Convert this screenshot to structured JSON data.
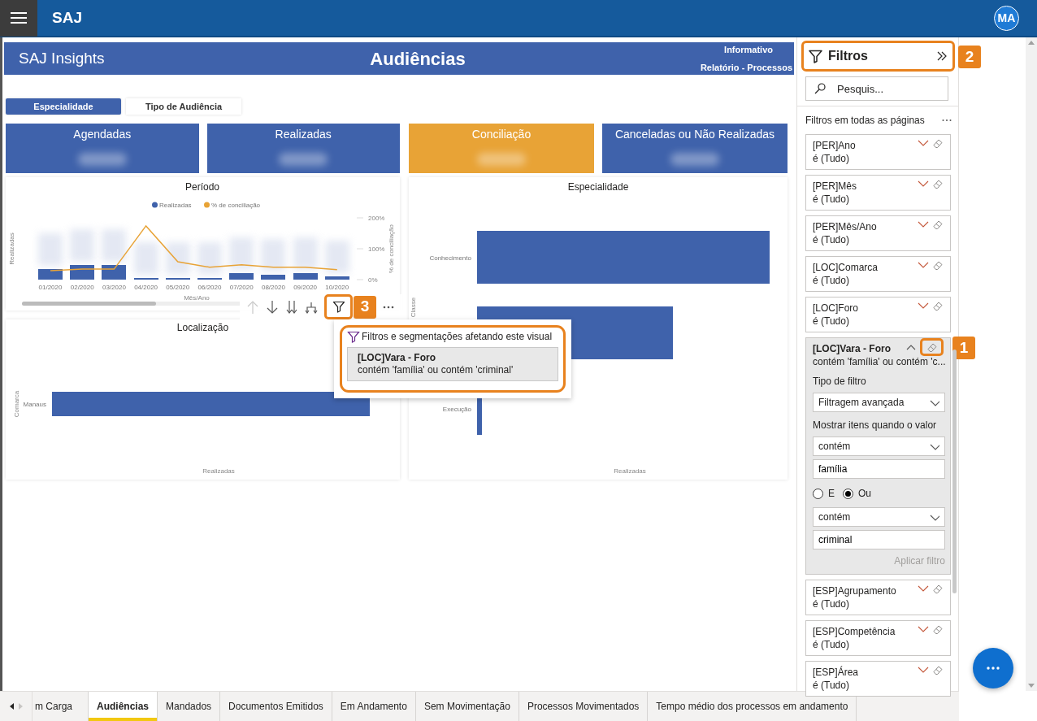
{
  "app": {
    "title": "SAJ",
    "user_initials": "MA"
  },
  "report": {
    "brand": "SAJ Insights",
    "title": "Audiências",
    "nav_links": [
      {
        "label": "Informativo"
      },
      {
        "label": "Relatório - Processos"
      }
    ],
    "toggles": [
      {
        "label": "Especialidade",
        "selected": true
      },
      {
        "label": "Tipo de Audiência",
        "selected": false
      }
    ],
    "kpis": [
      {
        "label": "Agendadas",
        "color": "#3f62ab"
      },
      {
        "label": "Realizadas",
        "color": "#3f62ab"
      },
      {
        "label": "Conciliação",
        "color": "#e8a336"
      },
      {
        "label": "Canceladas ou Não Realizadas",
        "color": "#3f62ab"
      }
    ],
    "periodo": {
      "title": "Período",
      "left_axis_title": "Realizadas",
      "legend": [
        {
          "label": "Realizadas",
          "color": "#3f62ab"
        }
      ],
      "chart_data": {
        "type": "line",
        "xlabel": "Mês/Ano",
        "ylabel": "% de conciliação",
        "categories": [
          "01/2020",
          "02/2020",
          "03/2020",
          "04/2020",
          "05/2020",
          "06/2020",
          "07/2020",
          "08/2020",
          "09/2020",
          "10/2020"
        ],
        "ylim": [
          0,
          200
        ],
        "yticks": [
          {
            "value": 0,
            "label": "0%"
          },
          {
            "value": 100,
            "label": "100%"
          },
          {
            "value": 200,
            "label": "200%"
          }
        ],
        "series": [
          {
            "name": "% de conciliação",
            "color": "#e8a336",
            "values": [
              29,
              34,
              34,
              174,
              58,
              40,
              48,
              40,
              40,
              32
            ]
          }
        ]
      }
    },
    "visual_toolbar": {
      "callout": "3"
    },
    "localizacao": {
      "title": "Localização",
      "ylabel": "Comarca",
      "xlabel": "Realizadas",
      "categories": [
        "Manaus"
      ]
    },
    "especialidade": {
      "title": "Especialidade",
      "ylabel": "Classe",
      "xlabel": "Realizadas",
      "categories": [
        "Conhecimento",
        "Execução"
      ]
    },
    "visual_filters_popup": {
      "heading": "Filtros e segmentações afetando este visual",
      "highlighted": true,
      "filters": [
        {
          "title": "[LOC]Vara - Foro",
          "summary": "contém 'família' ou contém 'criminal'"
        }
      ]
    }
  },
  "filter_pane": {
    "title": "Filtros",
    "callout": "2",
    "search": {
      "placeholder": "Pesquis..."
    },
    "section": "Filtros em todas as páginas",
    "filters": [
      {
        "title": "[PER]Ano",
        "summary": "é (Tudo)",
        "expanded": false
      },
      {
        "title": "[PER]Mês",
        "summary": "é (Tudo)",
        "expanded": false
      },
      {
        "title": "[PER]Mês/Ano",
        "summary": "é (Tudo)",
        "expanded": false
      },
      {
        "title": "[LOC]Comarca",
        "summary": "é (Tudo)",
        "expanded": false
      },
      {
        "title": "[LOC]Foro",
        "summary": "é (Tudo)",
        "expanded": false
      },
      {
        "title": "[LOC]Vara - Foro",
        "summary": "contém 'família' ou contém 'c...",
        "expanded": true,
        "callout": "1",
        "detail": {
          "type_label": "Tipo de filtro",
          "type_value": "Filtragem avançada",
          "show_label": "Mostrar itens quando o valor",
          "condition1": "contém",
          "value1": "família",
          "logic": [
            {
              "label": "E",
              "selected": false
            },
            {
              "label": "Ou",
              "selected": true
            }
          ],
          "condition2": "contém",
          "value2": "criminal",
          "apply_label": "Aplicar filtro",
          "apply_disabled": true
        }
      },
      {
        "title": "[ESP]Agrupamento",
        "summary": "é (Tudo)",
        "expanded": false
      },
      {
        "title": "[ESP]Competência",
        "summary": "é (Tudo)",
        "expanded": false
      },
      {
        "title": "[ESP]Área",
        "summary": "é (Tudo)",
        "expanded": false
      }
    ]
  },
  "page_tabs": [
    {
      "label": "m Carga",
      "selected": false
    },
    {
      "label": "Audiências",
      "selected": true
    },
    {
      "label": "Mandados",
      "selected": false
    },
    {
      "label": "Documentos Emitidos",
      "selected": false
    },
    {
      "label": "Em Andamento",
      "selected": false
    },
    {
      "label": "Sem Movimentação",
      "selected": false
    },
    {
      "label": "Processos Movimentados",
      "selected": false
    },
    {
      "label": "Tempo médio dos processos em andamento",
      "selected": false
    }
  ]
}
